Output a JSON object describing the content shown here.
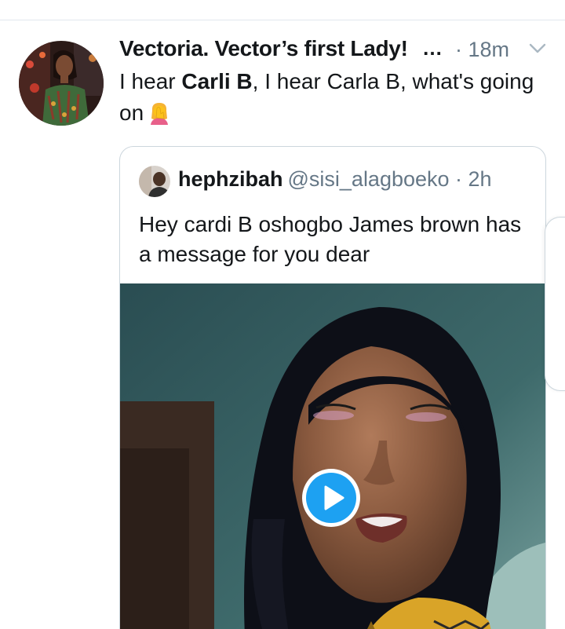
{
  "tweet": {
    "display_name": "Vectoria. Vector’s first Lady!",
    "name_truncation": "…",
    "timestamp": "· 18m",
    "text_prefix": "I hear ",
    "text_bold": "Carli B",
    "text_rest": ", I hear Carla B, what's going on",
    "emoji": "woman-facepalming-icon",
    "menu_icon": "chevron-down-icon"
  },
  "quoted_tweet": {
    "display_name": "hephzibah",
    "handle": "@sisi_alagboeko",
    "timestamp": " · 2h",
    "text": "Hey cardi B oshogbo James brown has a message for you dear",
    "media": {
      "type": "video",
      "play_icon": "play-icon"
    }
  },
  "colors": {
    "primary_text": "#14171a",
    "secondary_text": "#657786",
    "border": "#ccd6dd",
    "accent": "#1da1f2"
  }
}
